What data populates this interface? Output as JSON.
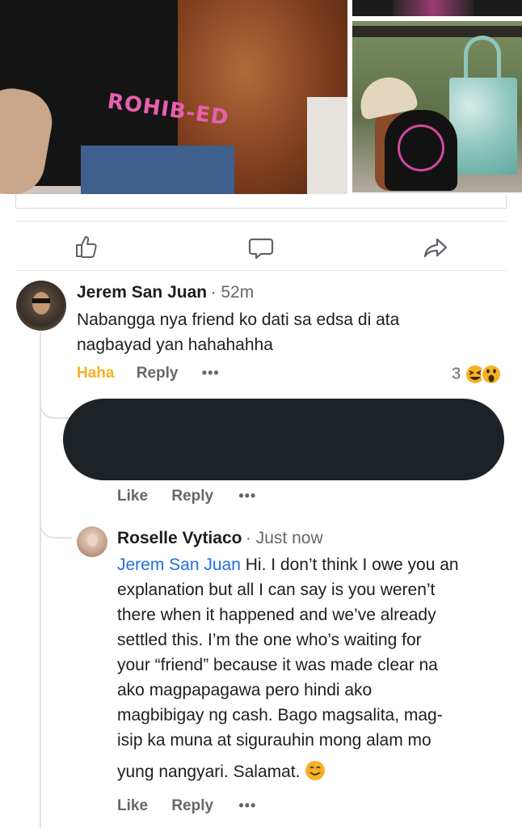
{
  "post": {
    "photo_print_text": "ROHIB-ED",
    "actions": [
      {
        "icon": "like-icon"
      },
      {
        "icon": "comment-icon"
      },
      {
        "icon": "share-icon"
      }
    ]
  },
  "comments": {
    "first": {
      "author": "Jerem San Juan",
      "time": "· 52m",
      "text_line1": "Nabangga nya friend ko dati sa edsa di ata",
      "text_line2": "nagbayad yan hahahahha",
      "reaction_label": "Haha",
      "reply_label": "Reply",
      "more_label": "•••",
      "reaction_count": "3",
      "reaction_icons": [
        "haha-emoji-icon",
        "wow-emoji-icon"
      ]
    },
    "redacted_reply": {
      "like_label": "Like",
      "reply_label": "Reply",
      "more_label": "•••"
    },
    "second": {
      "author": "Roselle Vytiaco",
      "time": "· Just now",
      "mention": "Jerem San Juan",
      "lines": [
        " Hi. I don’t think I owe you an",
        "explanation but all I can say is you weren’t",
        "there when it happened and we’ve already",
        "settled this. I’m the one who’s waiting for",
        "your “friend” because it was made clear na",
        "ako magpapagawa pero hindi ako",
        "magbibigay ng cash. Bago magsalita, mag-",
        "isip ka muna at sigurauhin mong alam mo",
        "yung nangyari. Salamat. "
      ],
      "emoji": "😊",
      "like_label": "Like",
      "reply_label": "Reply",
      "more_label": "•••"
    }
  },
  "colors": {
    "mention": "#216fdb",
    "haha": "#f7b125",
    "muted": "#65676b",
    "redaction": "#1d2226"
  }
}
